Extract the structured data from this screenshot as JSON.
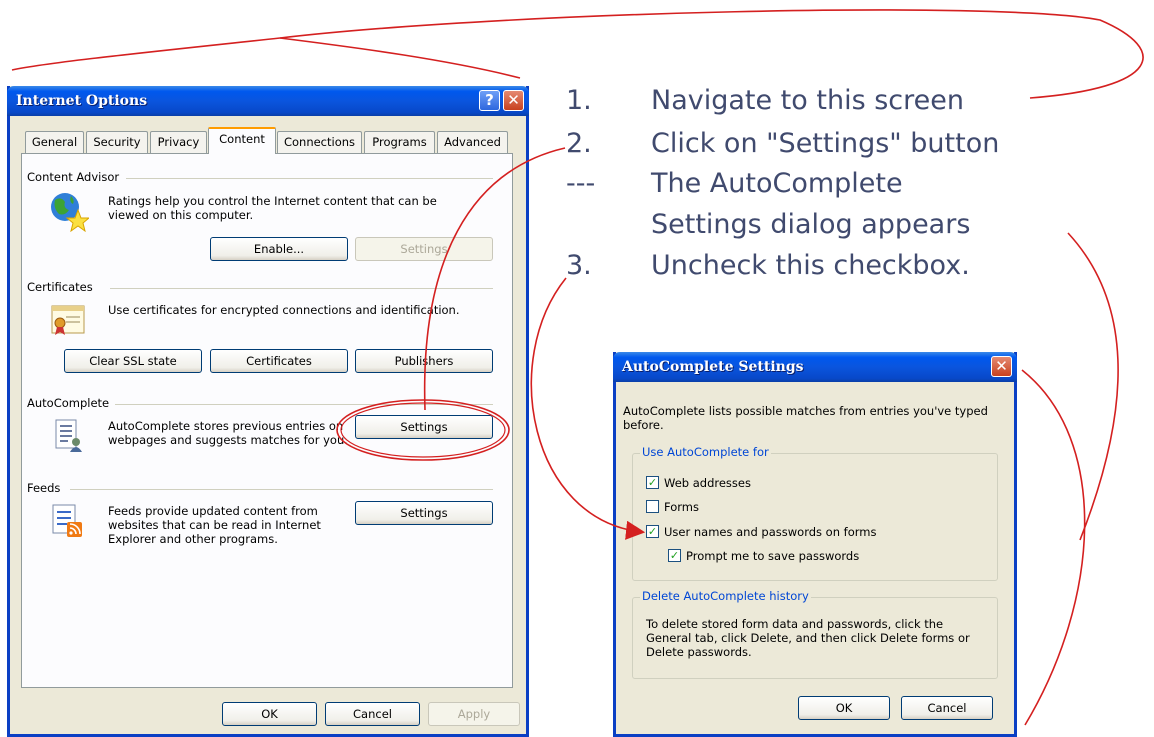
{
  "internet_options": {
    "title": "Internet Options",
    "help_glyph": "?",
    "close_glyph": "✕",
    "tabs": [
      "General",
      "Security",
      "Privacy",
      "Content",
      "Connections",
      "Programs",
      "Advanced"
    ],
    "active_tab": "Content",
    "content_advisor": {
      "title": "Content Advisor",
      "text": "Ratings help you control the Internet content that can be viewed on this computer.",
      "enable_label": "Enable...",
      "settings_label": "Settings"
    },
    "certificates": {
      "title": "Certificates",
      "text": "Use certificates for encrypted connections and identification.",
      "clear_ssl_label": "Clear SSL state",
      "certificates_label": "Certificates",
      "publishers_label": "Publishers"
    },
    "autocomplete": {
      "title": "AutoComplete",
      "text": "AutoComplete stores previous entries on webpages and suggests matches for you.",
      "settings_label": "Settings"
    },
    "feeds": {
      "title": "Feeds",
      "text": "Feeds provide updated content from websites that can be read in Internet Explorer and other programs.",
      "settings_label": "Settings"
    },
    "footer": {
      "ok_label": "OK",
      "cancel_label": "Cancel",
      "apply_label": "Apply"
    }
  },
  "autocomplete_settings": {
    "title": "AutoComplete Settings",
    "close_glyph": "✕",
    "intro": "AutoComplete lists possible matches from entries you've typed before.",
    "use_for_legend": "Use AutoComplete for",
    "options": [
      {
        "label": "Web addresses",
        "checked": true
      },
      {
        "label": "Forms",
        "checked": false
      },
      {
        "label": "User names and passwords on forms",
        "checked": true
      },
      {
        "label": "Prompt me to save passwords",
        "checked": true
      }
    ],
    "check_glyph": "✓",
    "delete_legend": "Delete AutoComplete history",
    "delete_text": "To delete stored form data and passwords, click the General tab, click Delete, and then click Delete forms or Delete passwords.",
    "ok_label": "OK",
    "cancel_label": "Cancel"
  },
  "instructions": [
    {
      "number": "1.",
      "text": "Navigate to this screen"
    },
    {
      "number": "2.",
      "text": "Click on \"Settings\" button"
    },
    {
      "number": "---",
      "text": "The AutoComplete"
    },
    {
      "number": "",
      "text": "Settings dialog appears"
    },
    {
      "number": "3.",
      "text": "Uncheck this checkbox."
    }
  ],
  "colors": {
    "annotation_red": "#d42020",
    "xp_title_blue": "#0a55de",
    "instruction_text": "#404a6e",
    "dialog_face": "#ece9d8"
  }
}
